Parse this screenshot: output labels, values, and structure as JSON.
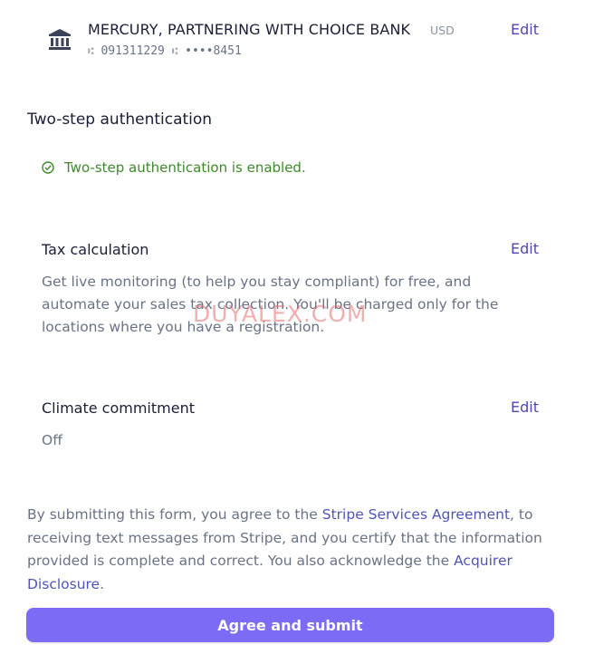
{
  "bank": {
    "name": "MERCURY, PARTNERING WITH CHOICE BANK",
    "currency": "USD",
    "routing": "091311229",
    "account": "••••8451",
    "edit_label": "Edit"
  },
  "two_step": {
    "title": "Two-step authentication",
    "status": "Two-step authentication is enabled."
  },
  "tax": {
    "title": "Tax calculation",
    "edit_label": "Edit",
    "description": "Get live monitoring (to help you stay compliant) for free, and automate your sales tax collection. You'll be charged only for the locations where you have a registration."
  },
  "climate": {
    "title": "Climate commitment",
    "edit_label": "Edit",
    "value": "Off"
  },
  "legal": {
    "part1": "By submitting this form, you agree to the ",
    "link1": "Stripe Services Agreement",
    "part2": ", to receiving text messages from Stripe, and you certify that the information provided is complete and correct. You also acknowledge the ",
    "link2": "Acquirer Disclosure",
    "part3": "."
  },
  "submit": {
    "label": "Agree and submit"
  },
  "watermark": "DUYALEX.COM",
  "colors": {
    "accent": "#7c6cf5",
    "link": "#4f46b6",
    "success": "#3d8a2a"
  }
}
